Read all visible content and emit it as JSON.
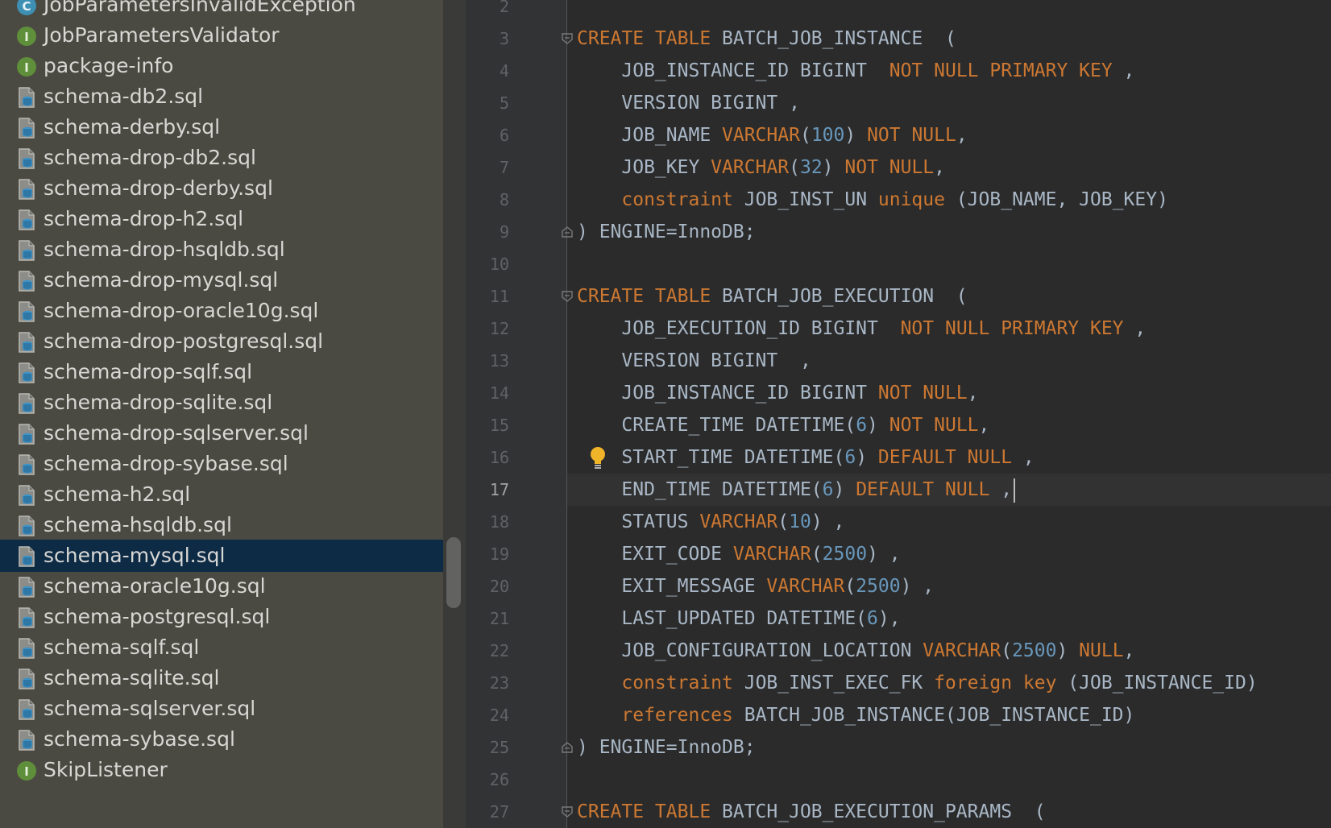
{
  "project_tree": {
    "items": [
      {
        "label": "JobParametersInvalidException",
        "icon": "class-icon",
        "selected": false
      },
      {
        "label": "JobParametersValidator",
        "icon": "interface-icon",
        "selected": false
      },
      {
        "label": "package-info",
        "icon": "interface-icon",
        "selected": false
      },
      {
        "label": "schema-db2.sql",
        "icon": "sql-file-icon",
        "selected": false
      },
      {
        "label": "schema-derby.sql",
        "icon": "sql-file-icon",
        "selected": false
      },
      {
        "label": "schema-drop-db2.sql",
        "icon": "sql-file-icon",
        "selected": false
      },
      {
        "label": "schema-drop-derby.sql",
        "icon": "sql-file-icon",
        "selected": false
      },
      {
        "label": "schema-drop-h2.sql",
        "icon": "sql-file-icon",
        "selected": false
      },
      {
        "label": "schema-drop-hsqldb.sql",
        "icon": "sql-file-icon",
        "selected": false
      },
      {
        "label": "schema-drop-mysql.sql",
        "icon": "sql-file-icon",
        "selected": false
      },
      {
        "label": "schema-drop-oracle10g.sql",
        "icon": "sql-file-icon",
        "selected": false
      },
      {
        "label": "schema-drop-postgresql.sql",
        "icon": "sql-file-icon",
        "selected": false
      },
      {
        "label": "schema-drop-sqlf.sql",
        "icon": "sql-file-icon",
        "selected": false
      },
      {
        "label": "schema-drop-sqlite.sql",
        "icon": "sql-file-icon",
        "selected": false
      },
      {
        "label": "schema-drop-sqlserver.sql",
        "icon": "sql-file-icon",
        "selected": false
      },
      {
        "label": "schema-drop-sybase.sql",
        "icon": "sql-file-icon",
        "selected": false
      },
      {
        "label": "schema-h2.sql",
        "icon": "sql-file-icon",
        "selected": false
      },
      {
        "label": "schema-hsqldb.sql",
        "icon": "sql-file-icon",
        "selected": false
      },
      {
        "label": "schema-mysql.sql",
        "icon": "sql-file-icon",
        "selected": true
      },
      {
        "label": "schema-oracle10g.sql",
        "icon": "sql-file-icon",
        "selected": false
      },
      {
        "label": "schema-postgresql.sql",
        "icon": "sql-file-icon",
        "selected": false
      },
      {
        "label": "schema-sqlf.sql",
        "icon": "sql-file-icon",
        "selected": false
      },
      {
        "label": "schema-sqlite.sql",
        "icon": "sql-file-icon",
        "selected": false
      },
      {
        "label": "schema-sqlserver.sql",
        "icon": "sql-file-icon",
        "selected": false
      },
      {
        "label": "schema-sybase.sql",
        "icon": "sql-file-icon",
        "selected": false
      },
      {
        "label": "SkipListener",
        "icon": "interface-icon",
        "selected": false
      }
    ]
  },
  "editor": {
    "current_line": 17,
    "lines": [
      {
        "n": "2",
        "tokens": []
      },
      {
        "n": "3",
        "fold": "open",
        "tokens": [
          [
            "kw",
            "CREATE TABLE "
          ],
          [
            "pl",
            "BATCH_JOB_INSTANCE  ("
          ]
        ]
      },
      {
        "n": "4",
        "tokens": [
          [
            "pl",
            "    JOB_INSTANCE_ID BIGINT  "
          ],
          [
            "kw",
            "NOT NULL PRIMARY KEY"
          ],
          [
            "pl",
            " ,"
          ]
        ]
      },
      {
        "n": "5",
        "tokens": [
          [
            "pl",
            "    VERSION BIGINT ,"
          ]
        ]
      },
      {
        "n": "6",
        "tokens": [
          [
            "pl",
            "    JOB_NAME "
          ],
          [
            "kw",
            "VARCHAR"
          ],
          [
            "pl",
            "("
          ],
          [
            "num",
            "100"
          ],
          [
            "pl",
            ") "
          ],
          [
            "kw",
            "NOT NULL"
          ],
          [
            "pl",
            ","
          ]
        ]
      },
      {
        "n": "7",
        "tokens": [
          [
            "pl",
            "    JOB_KEY "
          ],
          [
            "kw",
            "VARCHAR"
          ],
          [
            "pl",
            "("
          ],
          [
            "num",
            "32"
          ],
          [
            "pl",
            ") "
          ],
          [
            "kw",
            "NOT NULL"
          ],
          [
            "pl",
            ","
          ]
        ]
      },
      {
        "n": "8",
        "tokens": [
          [
            "kw",
            "    constraint "
          ],
          [
            "pl",
            "JOB_INST_UN "
          ],
          [
            "kw",
            "unique "
          ],
          [
            "pl",
            "(JOB_NAME, JOB_KEY)"
          ]
        ]
      },
      {
        "n": "9",
        "fold": "close",
        "tokens": [
          [
            "pl",
            ") ENGINE=InnoDB;"
          ]
        ]
      },
      {
        "n": "10",
        "tokens": []
      },
      {
        "n": "11",
        "fold": "open",
        "tokens": [
          [
            "kw",
            "CREATE TABLE "
          ],
          [
            "pl",
            "BATCH_JOB_EXECUTION  ("
          ]
        ]
      },
      {
        "n": "12",
        "tokens": [
          [
            "pl",
            "    JOB_EXECUTION_ID BIGINT  "
          ],
          [
            "kw",
            "NOT NULL PRIMARY KEY"
          ],
          [
            "pl",
            " ,"
          ]
        ]
      },
      {
        "n": "13",
        "tokens": [
          [
            "pl",
            "    VERSION BIGINT  ,"
          ]
        ]
      },
      {
        "n": "14",
        "tokens": [
          [
            "pl",
            "    JOB_INSTANCE_ID BIGINT "
          ],
          [
            "kw",
            "NOT NULL"
          ],
          [
            "pl",
            ","
          ]
        ]
      },
      {
        "n": "15",
        "tokens": [
          [
            "pl",
            "    CREATE_TIME DATETIME("
          ],
          [
            "num",
            "6"
          ],
          [
            "pl",
            ") "
          ],
          [
            "kw",
            "NOT NULL"
          ],
          [
            "pl",
            ","
          ]
        ]
      },
      {
        "n": "16",
        "bulb": true,
        "tokens": [
          [
            "pl",
            "    START_TIME DATETIME("
          ],
          [
            "num",
            "6"
          ],
          [
            "pl",
            ") "
          ],
          [
            "kw",
            "DEFAULT NULL"
          ],
          [
            "pl",
            " ,"
          ]
        ]
      },
      {
        "n": "17",
        "caret": true,
        "tokens": [
          [
            "pl",
            "    END_TIME DATETIME("
          ],
          [
            "num",
            "6"
          ],
          [
            "pl",
            ") "
          ],
          [
            "kw",
            "DEFAULT NULL"
          ],
          [
            "pl",
            " ,"
          ]
        ]
      },
      {
        "n": "18",
        "tokens": [
          [
            "pl",
            "    STATUS "
          ],
          [
            "kw",
            "VARCHAR"
          ],
          [
            "pl",
            "("
          ],
          [
            "num",
            "10"
          ],
          [
            "pl",
            ") ,"
          ]
        ]
      },
      {
        "n": "19",
        "tokens": [
          [
            "pl",
            "    EXIT_CODE "
          ],
          [
            "kw",
            "VARCHAR"
          ],
          [
            "pl",
            "("
          ],
          [
            "num",
            "2500"
          ],
          [
            "pl",
            ") ,"
          ]
        ]
      },
      {
        "n": "20",
        "tokens": [
          [
            "pl",
            "    EXIT_MESSAGE "
          ],
          [
            "kw",
            "VARCHAR"
          ],
          [
            "pl",
            "("
          ],
          [
            "num",
            "2500"
          ],
          [
            "pl",
            ") ,"
          ]
        ]
      },
      {
        "n": "21",
        "tokens": [
          [
            "pl",
            "    LAST_UPDATED DATETIME("
          ],
          [
            "num",
            "6"
          ],
          [
            "pl",
            "),"
          ]
        ]
      },
      {
        "n": "22",
        "tokens": [
          [
            "pl",
            "    JOB_CONFIGURATION_LOCATION "
          ],
          [
            "kw",
            "VARCHAR"
          ],
          [
            "pl",
            "("
          ],
          [
            "num",
            "2500"
          ],
          [
            "pl",
            ") "
          ],
          [
            "kw",
            "NULL"
          ],
          [
            "pl",
            ","
          ]
        ]
      },
      {
        "n": "23",
        "tokens": [
          [
            "kw",
            "    constraint "
          ],
          [
            "pl",
            "JOB_INST_EXEC_FK "
          ],
          [
            "kw",
            "foreign key "
          ],
          [
            "pl",
            "(JOB_INSTANCE_ID)"
          ]
        ]
      },
      {
        "n": "24",
        "tokens": [
          [
            "kw",
            "    references "
          ],
          [
            "pl",
            "BATCH_JOB_INSTANCE(JOB_INSTANCE_ID)"
          ]
        ]
      },
      {
        "n": "25",
        "fold": "close",
        "tokens": [
          [
            "pl",
            ") ENGINE=InnoDB;"
          ]
        ]
      },
      {
        "n": "26",
        "tokens": []
      },
      {
        "n": "27",
        "fold": "open",
        "tokens": [
          [
            "kw",
            "CREATE TABLE "
          ],
          [
            "pl",
            "BATCH_JOB_EXECUTION_PARAMS  ("
          ]
        ]
      }
    ]
  },
  "colors": {
    "keyword": "#cc7832",
    "number": "#6897bb",
    "plain": "#a9b7c6",
    "tree_bg": "#4b4a42",
    "tree_selected": "#0e2b46",
    "editor_bg": "#2b2b2b"
  }
}
